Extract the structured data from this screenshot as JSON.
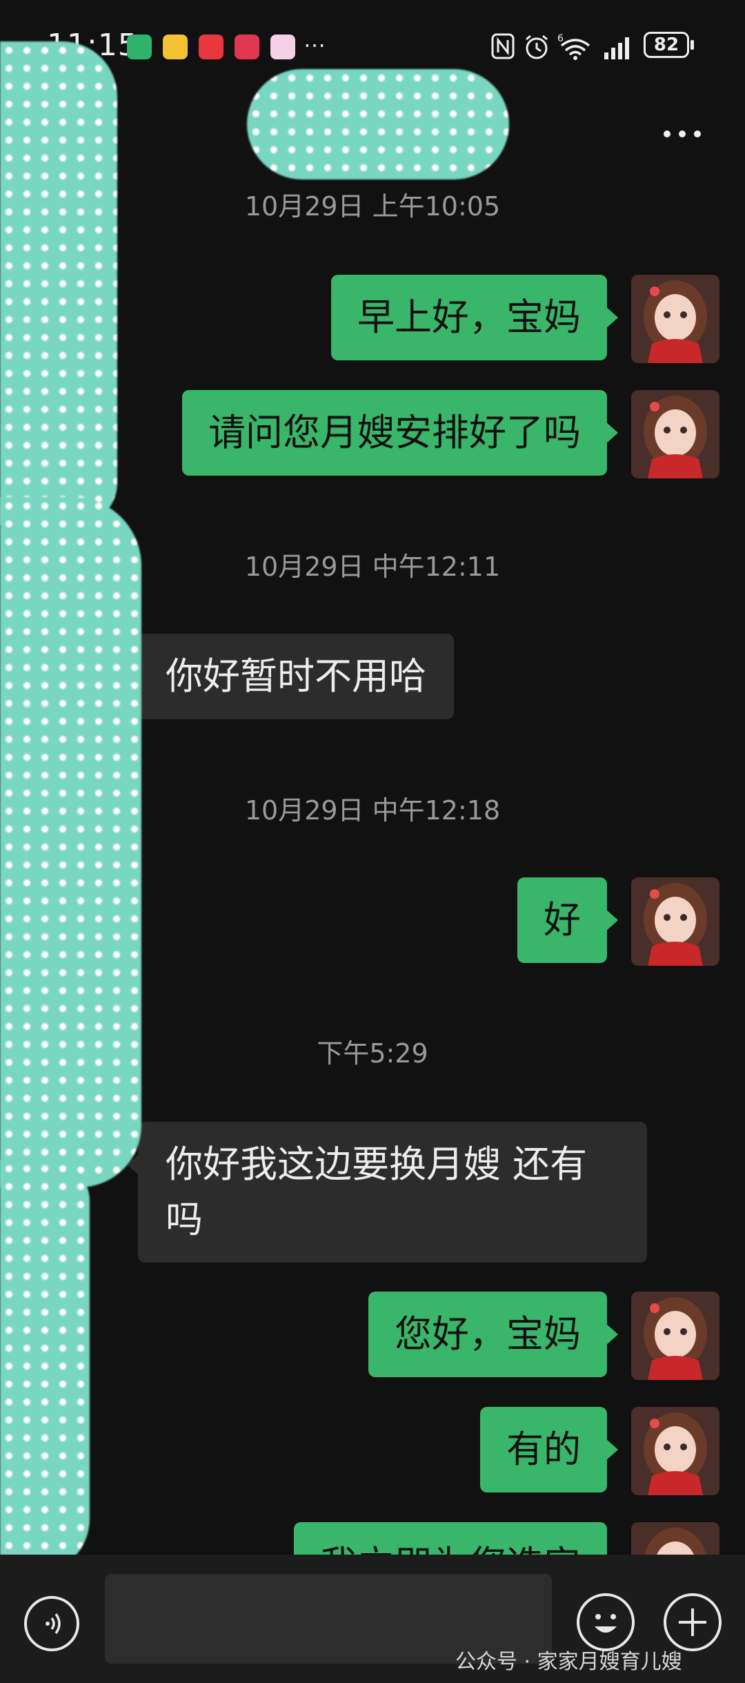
{
  "status_bar": {
    "time": "11:15",
    "more": "…",
    "battery": "82",
    "signal_label": "6"
  },
  "header": {
    "more_icon": "more-horizontal-icon"
  },
  "messages": [
    {
      "type": "timestamp",
      "text": "10月29日 上午10:05"
    },
    {
      "type": "out",
      "text": "早上好，宝妈"
    },
    {
      "type": "out",
      "text": "请问您月嫂安排好了吗"
    },
    {
      "type": "timestamp",
      "text": "10月29日 中午12:11"
    },
    {
      "type": "in",
      "text": "你好暂时不用哈"
    },
    {
      "type": "timestamp",
      "text": "10月29日 中午12:18"
    },
    {
      "type": "out",
      "text": "好"
    },
    {
      "type": "timestamp",
      "text": "下午5:29"
    },
    {
      "type": "in",
      "line1": "你好我这边要换月嫂 还有",
      "line2": "吗"
    },
    {
      "type": "out",
      "text": "您好，宝妈"
    },
    {
      "type": "out",
      "text": "有的"
    },
    {
      "type": "out",
      "text": "我立即为您选安"
    }
  ],
  "watermark": "公众号 · 家家月嫂育儿嫂",
  "colors": {
    "background": "#111111",
    "outgoing_bubble": "#39b66a",
    "incoming_bubble": "#2c2c2c",
    "redaction": "#79d6c0"
  }
}
